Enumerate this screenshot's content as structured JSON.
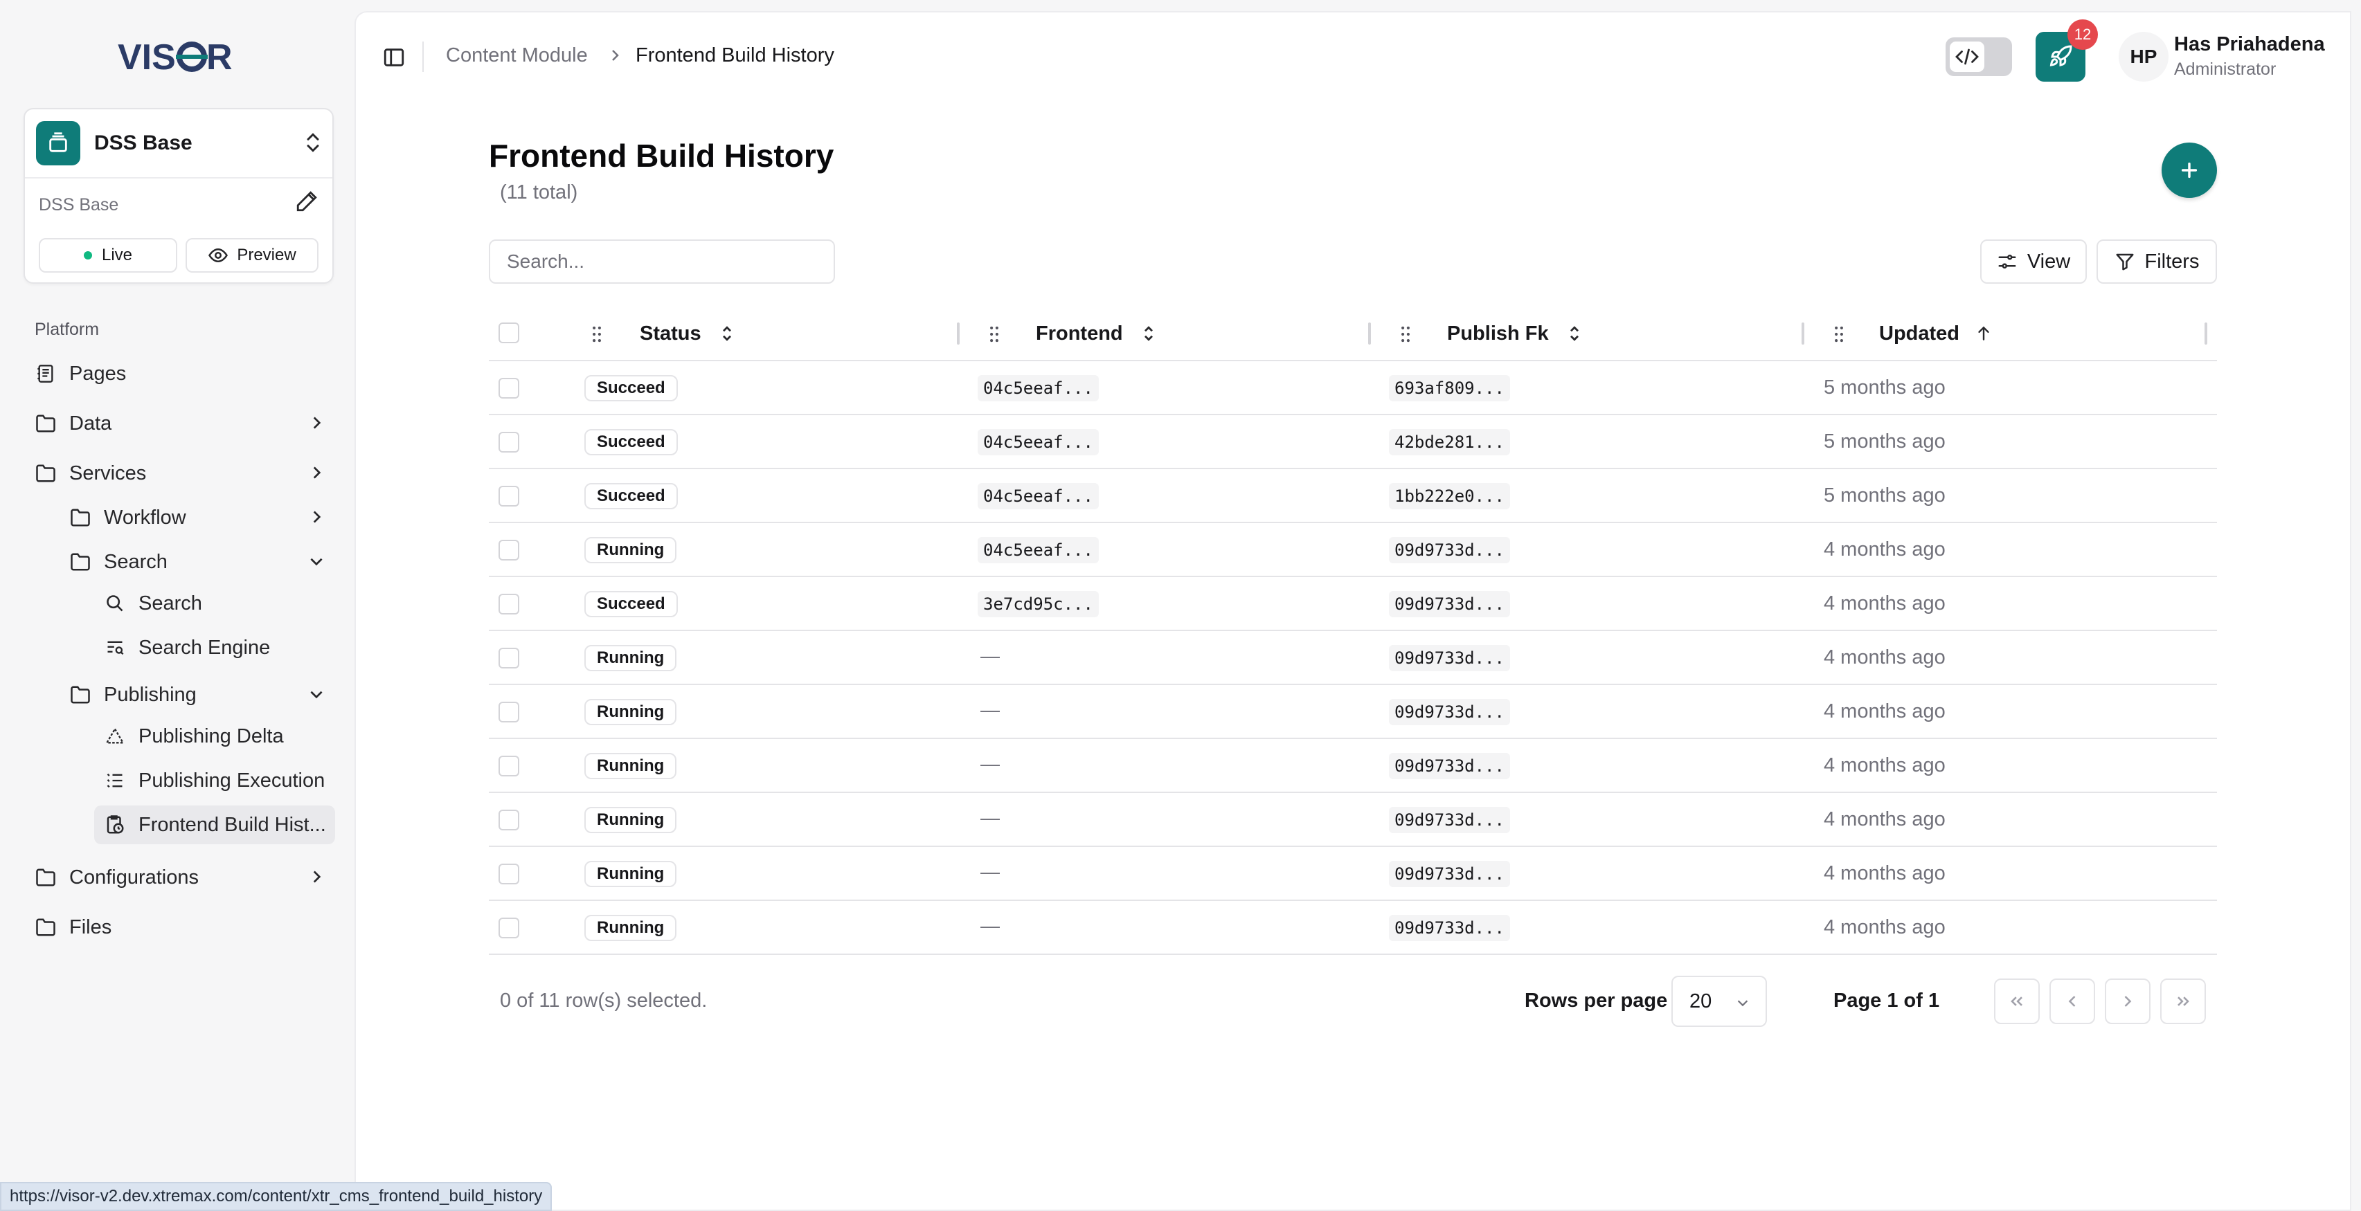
{
  "app": {
    "logo_text": "VISOR"
  },
  "workspace": {
    "name": "DSS Base",
    "subtitle": "DSS Base",
    "live_label": "Live",
    "preview_label": "Preview"
  },
  "sidebar": {
    "section_label": "Platform",
    "items": {
      "pages": "Pages",
      "data": "Data",
      "services": "Services",
      "workflow": "Workflow",
      "search": "Search",
      "search_sub": "Search",
      "search_engine": "Search Engine",
      "publishing": "Publishing",
      "publishing_delta": "Publishing Delta",
      "publishing_execution": "Publishing Execution",
      "frontend_build_history": "Frontend Build Hist...",
      "configurations": "Configurations",
      "files": "Files"
    }
  },
  "header": {
    "breadcrumb": [
      "Content Module",
      "Frontend Build History"
    ],
    "notification_count": "12",
    "user": {
      "initials": "HP",
      "name": "Has Priahadena",
      "role": "Administrator"
    }
  },
  "page": {
    "title": "Frontend Build History",
    "count": "(11 total)",
    "search_placeholder": "Search...",
    "view_label": "View",
    "filters_label": "Filters"
  },
  "table": {
    "columns": [
      "Status",
      "Frontend",
      "Publish Fk",
      "Updated"
    ],
    "rows": [
      {
        "status": "Succeed",
        "frontend": "04c5eeaf...",
        "publish_fk": "693af809...",
        "updated": "5 months ago"
      },
      {
        "status": "Succeed",
        "frontend": "04c5eeaf...",
        "publish_fk": "42bde281...",
        "updated": "5 months ago"
      },
      {
        "status": "Succeed",
        "frontend": "04c5eeaf...",
        "publish_fk": "1bb222e0...",
        "updated": "5 months ago"
      },
      {
        "status": "Running",
        "frontend": "04c5eeaf...",
        "publish_fk": "09d9733d...",
        "updated": "4 months ago"
      },
      {
        "status": "Succeed",
        "frontend": "3e7cd95c...",
        "publish_fk": "09d9733d...",
        "updated": "4 months ago"
      },
      {
        "status": "Running",
        "frontend": "—",
        "publish_fk": "09d9733d...",
        "updated": "4 months ago"
      },
      {
        "status": "Running",
        "frontend": "—",
        "publish_fk": "09d9733d...",
        "updated": "4 months ago"
      },
      {
        "status": "Running",
        "frontend": "—",
        "publish_fk": "09d9733d...",
        "updated": "4 months ago"
      },
      {
        "status": "Running",
        "frontend": "—",
        "publish_fk": "09d9733d...",
        "updated": "4 months ago"
      },
      {
        "status": "Running",
        "frontend": "—",
        "publish_fk": "09d9733d...",
        "updated": "4 months ago"
      },
      {
        "status": "Running",
        "frontend": "—",
        "publish_fk": "09d9733d...",
        "updated": "4 months ago"
      }
    ]
  },
  "footer": {
    "selected_text": "0 of 11 row(s) selected.",
    "rows_per_page_label": "Rows per page",
    "rows_per_page_value": "20",
    "page_label": "Page 1 of 1"
  },
  "status_bar": {
    "url": "https://visor-v2.dev.xtremax.com/content/xtr_cms_frontend_build_history"
  },
  "colors": {
    "accent": "#0f7c79",
    "badge_red": "#e5484d",
    "live_dot": "#10b981"
  }
}
